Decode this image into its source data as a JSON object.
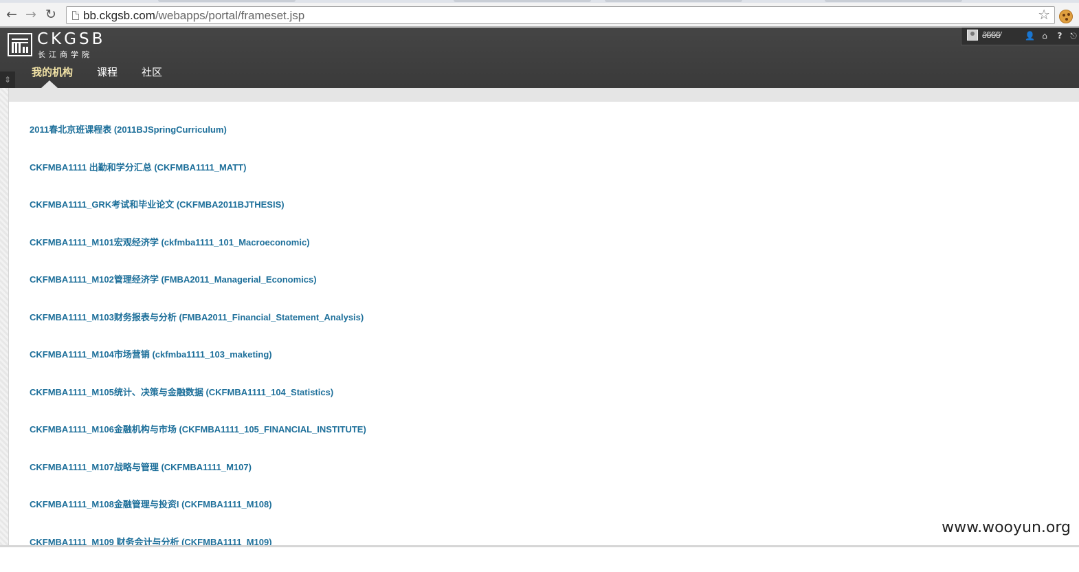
{
  "browser": {
    "url_host": "bb.ckgsb.com",
    "url_path": "/webapps/portal/frameset.jsp",
    "back_icon": "←",
    "forward_icon": "→",
    "reload_icon": "↻",
    "star_icon": "☆"
  },
  "header": {
    "logo_letters": "CKGSB",
    "logo_cn": "长江商学院",
    "user_name": "ẽ̸ẽ̸ẽ̸ẽ̸",
    "tabs": [
      {
        "label": "我的机构",
        "active": true
      },
      {
        "label": "课程",
        "active": false
      },
      {
        "label": "社区",
        "active": false
      }
    ],
    "icons": [
      "user-icon",
      "home-icon",
      "help-icon",
      "logout-icon"
    ]
  },
  "courses": [
    "2011春北京班课程表 (2011BJSpringCurriculum)",
    "CKFMBA1111 出勤和学分汇总 (CKFMBA1111_MATT)",
    "CKFMBA1111_GRK考试和毕业论文 (CKFMBA2011BJTHESIS)",
    "CKFMBA1111_M101宏观经济学 (ckfmba1111_101_Macroeconomic)",
    "CKFMBA1111_M102管理经济学 (FMBA2011_Managerial_Economics)",
    "CKFMBA1111_M103财务报表与分析 (FMBA2011_Financial_Statement_Analysis)",
    "CKFMBA1111_M104市场营销 (ckfmba1111_103_maketing)",
    "CKFMBA1111_M105统计、决策与金融数据 (CKFMBA1111_104_Statistics)",
    "CKFMBA1111_M106金融机构与市场 (CKFMBA1111_105_FINANCIAL_INSTITUTE)",
    "CKFMBA1111_M107战略与管理 (CKFMBA1111_M107)",
    "CKFMBA1111_M108金融管理与投资I (CKFMBA1111_M108)",
    "CKFMBA1111_M109 财务会计与分析 (CKFMBA1111_M109)"
  ],
  "watermark": "www.wooyun.org"
}
